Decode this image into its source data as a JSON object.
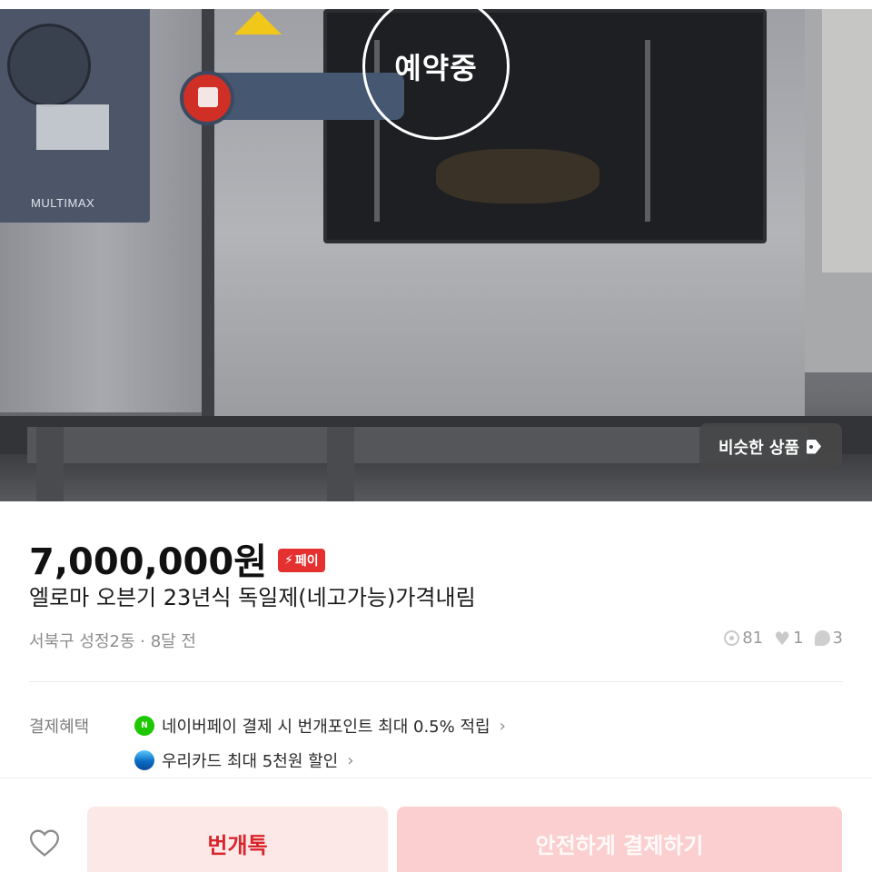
{
  "photo": {
    "reservation_status": "예약중",
    "brand_text": "MULTIMAX",
    "similar_button_label": "비슷한 상품"
  },
  "listing": {
    "price": "7,000,000원",
    "pay_badge_label": "페이",
    "title": "엘로마 오븐기 23년식 독일제(네고가능)가격내림",
    "location_time": "서북구 성정2동 · 8달 전",
    "views": "81",
    "likes": "1",
    "chats": "3"
  },
  "benefits": {
    "label": "결제혜택",
    "items": [
      {
        "icon": "naver-pay-icon",
        "text": "네이버페이 결제 시 번개포인트 최대 0.5% 적립"
      },
      {
        "icon": "woori-card-icon",
        "text": "우리카드 최대 5천원 할인"
      }
    ]
  },
  "bottom_bar": {
    "chat_button_label": "번개톡",
    "pay_button_label": "안전하게 결제하기"
  },
  "colors": {
    "accent_red": "#d8252b",
    "pay_badge": "#e53030",
    "chat_bg": "#fde8e8",
    "pay_button_bg": "#fbcfcf",
    "naver_green": "#1ec800"
  }
}
